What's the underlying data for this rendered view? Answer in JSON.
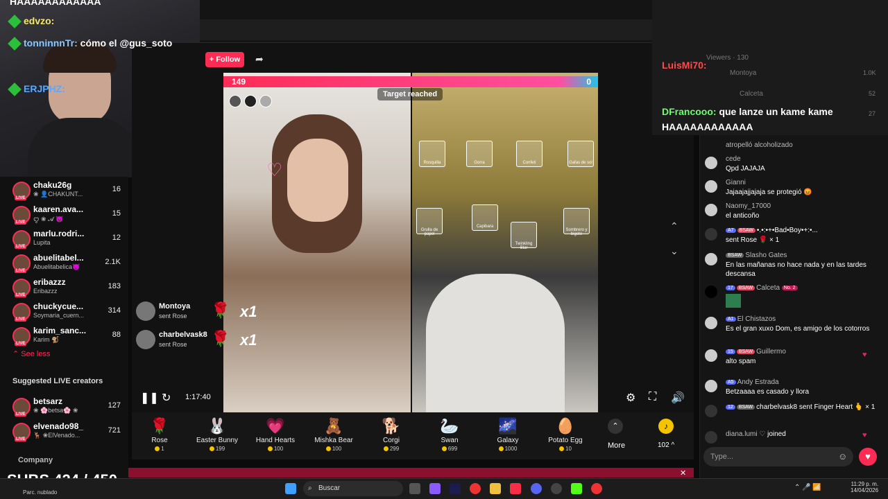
{
  "header": {
    "follow_label": "+ Follow"
  },
  "sidebar": {
    "items": [
      {
        "name": "chaku26g",
        "sub": "❀ 👤CHAKUNT...",
        "count": "16"
      },
      {
        "name": "kaaren.ava...",
        "sub": "ꨄ ❀ 𝓐 😈",
        "count": "15"
      },
      {
        "name": "marlu.rodri...",
        "sub": "Lupita",
        "count": "12"
      },
      {
        "name": "abuelitabel...",
        "sub": "Abuelitabelica😈",
        "count": "2.1K"
      },
      {
        "name": "eribazzz",
        "sub": "Eribazzz",
        "count": "183"
      },
      {
        "name": "chuckycue...",
        "sub": "Soymaria_cuern...",
        "count": "314"
      },
      {
        "name": "karim_sanc...",
        "sub": "Karim 🐒",
        "count": "88"
      }
    ],
    "see_less": "See less",
    "suggested_title": "Suggested LIVE creators",
    "suggested": [
      {
        "name": "betsarz",
        "sub": "❀ 🌸betsa🌸 ❀",
        "count": "127"
      },
      {
        "name": "elvenado98_",
        "sub": "🦌 ❀ElVenado...",
        "count": "721"
      }
    ],
    "company": "Company",
    "live_badge": "LIVE"
  },
  "video": {
    "score_left": "149",
    "score_right": "0",
    "target_label": "Target reached",
    "time": "1:17:40",
    "overlay_gifts": [
      "Rosquilla",
      "Gorra",
      "Confeti",
      "Gafas de sol",
      "Grulla de papel",
      "Capibara",
      "Twinkling Star",
      "Sombrero y bigote"
    ]
  },
  "gift_history": [
    {
      "user": "Montoya",
      "sub": "sent Rose",
      "mult": "x1"
    },
    {
      "user": "charbelvask8",
      "sub": "sent Rose",
      "mult": "x1"
    }
  ],
  "gifts": [
    {
      "name": "Rose",
      "price": "1",
      "icon": "🌹"
    },
    {
      "name": "Easter Bunny",
      "price": "199",
      "icon": "🐰"
    },
    {
      "name": "Hand Hearts",
      "price": "100",
      "icon": "💗"
    },
    {
      "name": "Mishka Bear",
      "price": "100",
      "icon": "🧸"
    },
    {
      "name": "Corgi",
      "price": "299",
      "icon": "🐕"
    },
    {
      "name": "Swan",
      "price": "699",
      "icon": "🦢"
    },
    {
      "name": "Galaxy",
      "price": "1000",
      "icon": "🌌"
    },
    {
      "name": "Potato Egg",
      "price": "10",
      "icon": "🥚"
    }
  ],
  "gift_more": "More",
  "coins": "102 ^",
  "overlay_chat": [
    {
      "user": "HAAAAAAAAAAAA",
      "text": ""
    },
    {
      "user": "edvzo:",
      "text": ""
    },
    {
      "user": "tonninnnTr:",
      "text": "cómo el @gus_soto"
    },
    {
      "user": "LuisMi70:",
      "text": ""
    },
    {
      "user": "ERJPHZ:",
      "text": ""
    },
    {
      "user": "DFrancooo:",
      "text": "que lanze un kame kame"
    },
    {
      "user": "HAAAAAAAAAAAA",
      "text": ""
    }
  ],
  "viewers_panel": {
    "label": "Viewers · 130",
    "v1": "Montoya",
    "v1c": "1.0K",
    "v2": "Calceta",
    "v2c": "52",
    "v3c": "27"
  },
  "chat": [
    {
      "user": "",
      "text": "atropelló alcoholizado"
    },
    {
      "user": "cede",
      "text": "Qpd JAJAJA"
    },
    {
      "user": "Gianni",
      "text": "Jajaajajjajaja se protegió 😡"
    },
    {
      "user": "Naomy_17000",
      "text": "el anticoño"
    },
    {
      "user": "•.•:•+•Bad•Boy•+:•...",
      "text": "sent Rose 🌹 × 1",
      "badges": [
        "A7",
        "BSAW"
      ]
    },
    {
      "user": "Slasho Gates",
      "text": "En las mañanas no hace nada y en las tardes descansa",
      "badges": [
        "BSAW"
      ]
    },
    {
      "user": "Calceta",
      "text": "",
      "badges": [
        "17",
        "BSAW",
        "No. 2"
      ]
    },
    {
      "user": "El Chistazos",
      "text": "Es el gran xuxo Dom, es amigo de los cotorros",
      "badges": [
        "A1"
      ]
    },
    {
      "user": "Guillermo",
      "text": "alto spam",
      "badges": [
        "15",
        "BSAW"
      ]
    },
    {
      "user": "Andy Estrada",
      "text": "Betzaaaa es casado y llora",
      "badges": [
        "A5"
      ]
    },
    {
      "user": "charbelvask8",
      "text": "sent Finger Heart 🫰 × 1",
      "badges": [
        "12",
        "BSAW"
      ]
    },
    {
      "user": "diana.lumi ♡",
      "text": "joined"
    }
  ],
  "chat_input_placeholder": "Type...",
  "taskbar": {
    "search": "Buscar",
    "time": "11:29 p. m.",
    "date": "14/04/2026",
    "weather": "Parc. nublado"
  },
  "subs_overlay": "SUBS 424 / 450"
}
